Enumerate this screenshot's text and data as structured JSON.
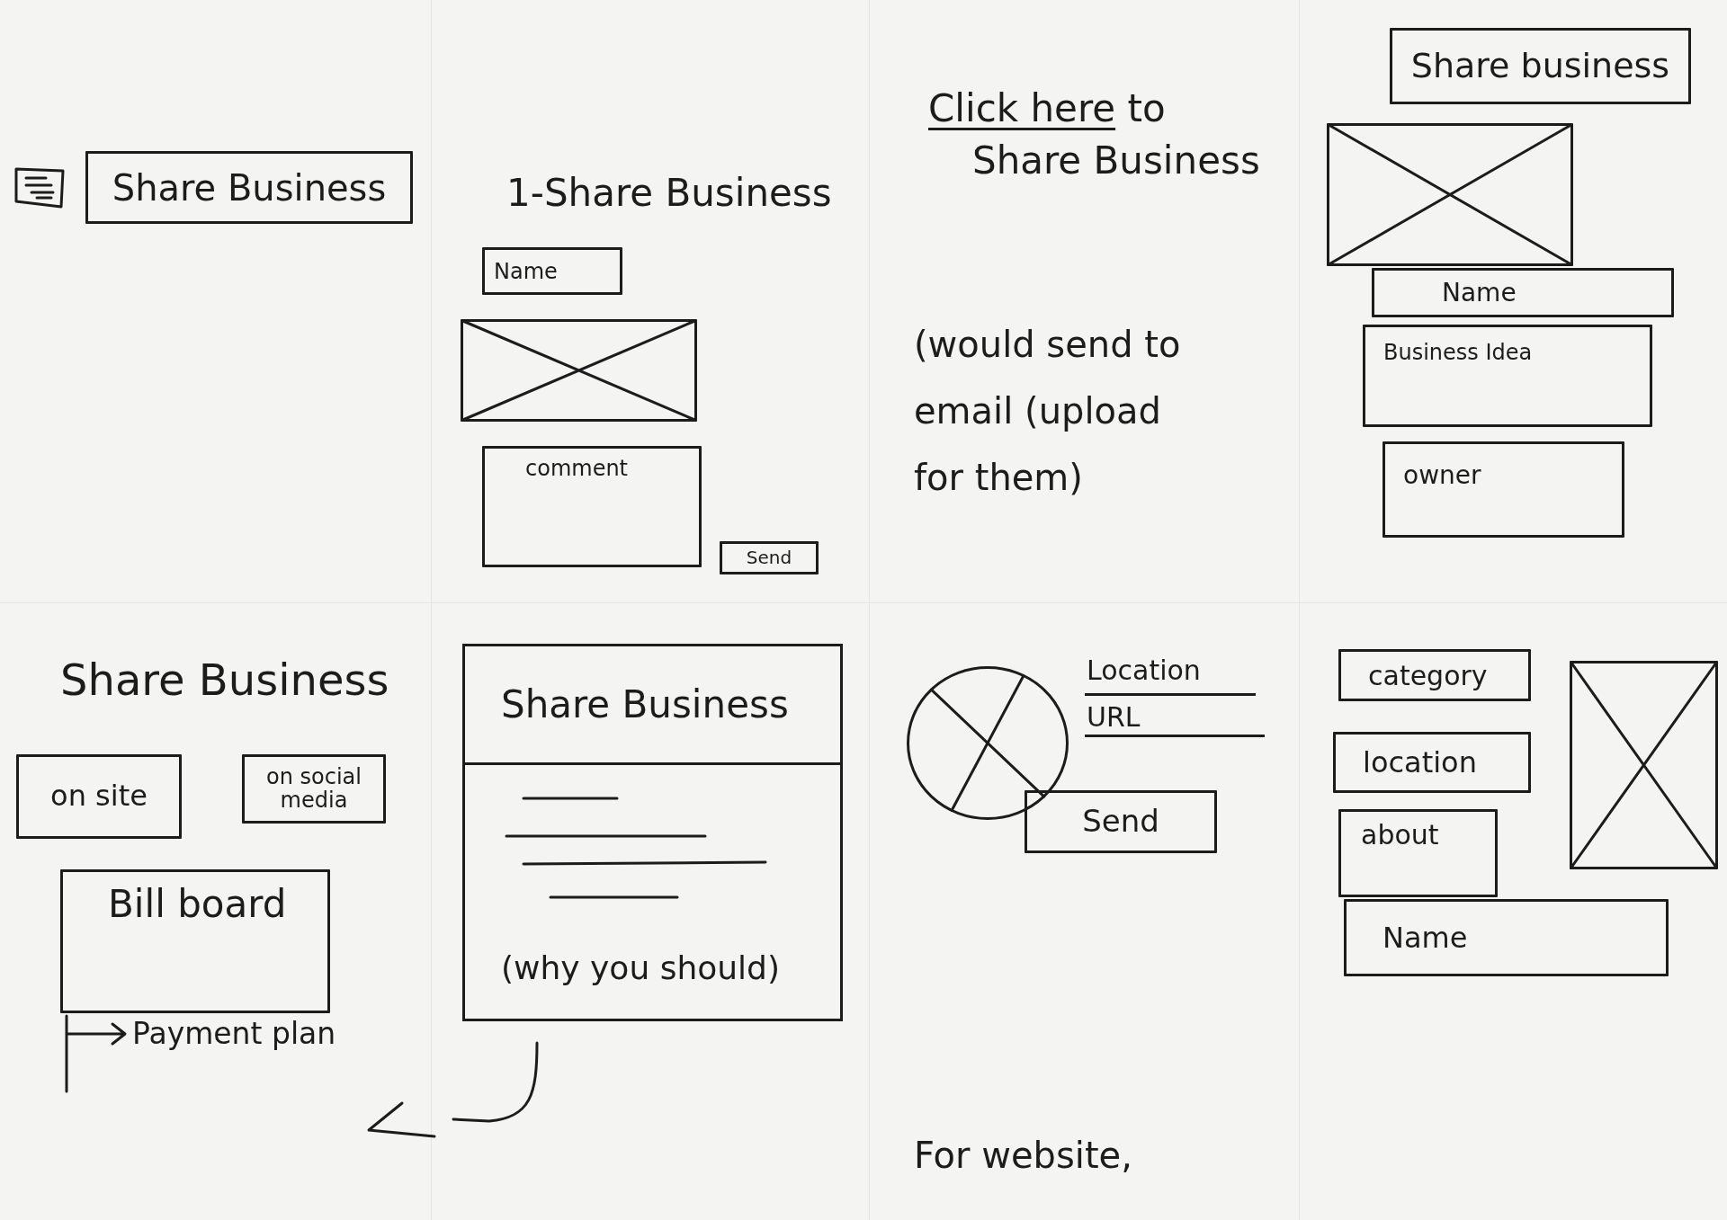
{
  "panels": [
    {
      "kind": "entry",
      "share_button": "Share Business"
    },
    {
      "kind": "upload_form",
      "title": "1-Share Business",
      "name_field": {
        "placeholder": "Name"
      },
      "comment_field": {
        "placeholder": "comment"
      },
      "send_button": "Send"
    },
    {
      "kind": "email_note",
      "link": "Click here",
      "link_text": "to Share Business",
      "note_lines": [
        "(would send to",
        "email (upload",
        "for them)"
      ]
    },
    {
      "kind": "business_form",
      "header_button": "Share business",
      "fields": [
        {
          "kind": "line",
          "placeholder": "Name"
        },
        {
          "kind": "area",
          "placeholder": "Business Idea"
        },
        {
          "kind": "area",
          "placeholder": "owner"
        }
      ]
    },
    {
      "kind": "share_options",
      "title": "Share Business",
      "options": [
        "on site",
        "on social media"
      ],
      "billboard": "Bill board",
      "payment_plan": "Payment plan"
    },
    {
      "kind": "info_card",
      "title": "Share Business",
      "footer": "(why you should)"
    },
    {
      "kind": "location_form",
      "fields": [
        {
          "placeholder": "Location"
        },
        {
          "placeholder": "URL"
        }
      ],
      "send_button": "Send",
      "caption": "For website,"
    },
    {
      "kind": "details_form",
      "fields": [
        {
          "kind": "line",
          "placeholder": "category"
        },
        {
          "kind": "line",
          "placeholder": "location"
        },
        {
          "kind": "area",
          "placeholder": "about"
        }
      ],
      "name_field": {
        "placeholder": "Name"
      }
    }
  ]
}
